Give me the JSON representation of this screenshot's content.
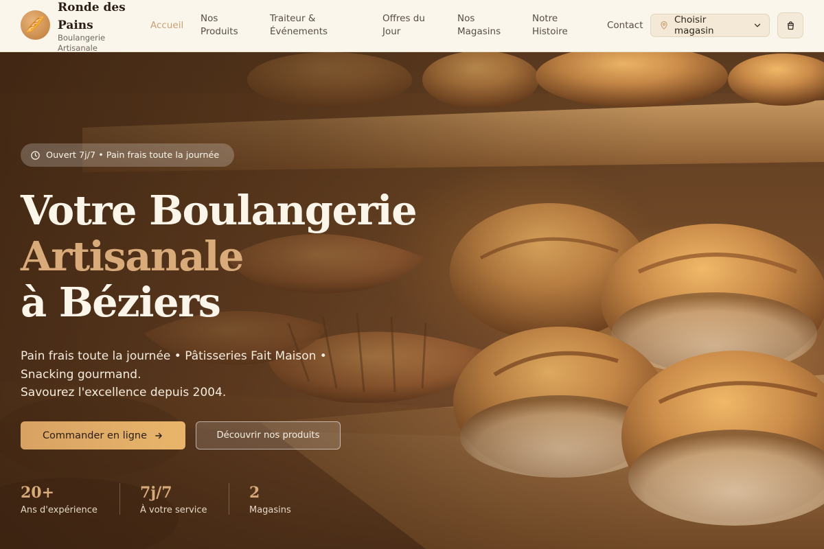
{
  "brand": {
    "name": "Ronde des Pains",
    "tagline": "Boulangerie Artisanale",
    "logo_icon": "baguette-icon"
  },
  "nav": {
    "items": [
      {
        "label": "Accueil",
        "active": true
      },
      {
        "label": "Nos Produits"
      },
      {
        "label": "Traiteur & Événements"
      },
      {
        "label": "Offres du Jour"
      },
      {
        "label": "Nos Magasins"
      },
      {
        "label": "Notre Histoire"
      },
      {
        "label": "Contact"
      }
    ],
    "store_selector": {
      "label": "Choisir magasin",
      "icon": "map-pin-icon"
    },
    "cart_icon": "shopping-bag-icon"
  },
  "hero": {
    "badge": "Ouvert 7j/7 • Pain frais toute la journée",
    "title_line1": "Votre Boulangerie",
    "title_line2": "Artisanale",
    "title_line3": "à Béziers",
    "lead_line1": "Pain frais toute la journée • Pâtisseries Fait Maison •",
    "lead_line2": "Snacking gourmand.",
    "lead_line3": "Savourez l'excellence depuis 2004.",
    "primary_button": "Commander en ligne",
    "secondary_button": "Découvrir nos produits",
    "stats": [
      {
        "value": "20+",
        "label": "Ans d'expérience"
      },
      {
        "value": "7j/7",
        "label": "À votre service"
      },
      {
        "value": "2",
        "label": "Magasins"
      }
    ]
  },
  "colors": {
    "accent": "#d9ab7b",
    "header_bg": "#faf6ec",
    "button_primary": "#e2ad68",
    "nav_active": "#c9a073"
  }
}
